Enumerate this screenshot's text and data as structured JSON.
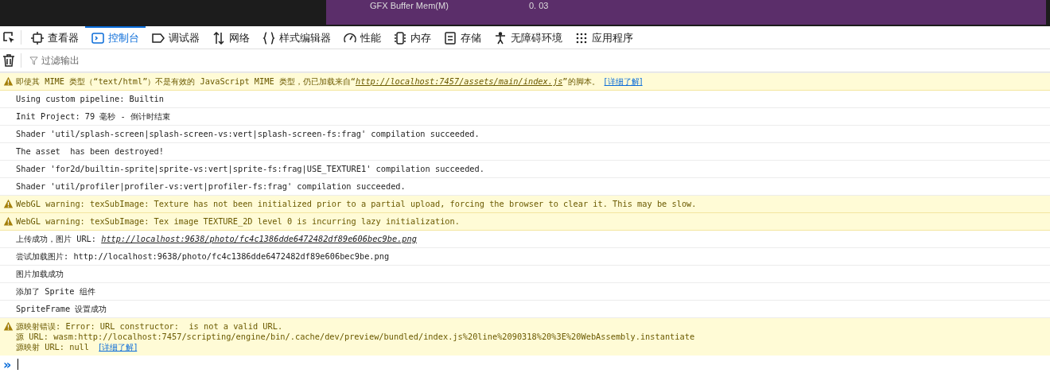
{
  "game_overlay": {
    "stats": [
      {
        "label": "GFX Buffer Mem(M)",
        "value": "0. 03"
      }
    ]
  },
  "tabs": [
    {
      "label": "查看器",
      "kind": "inspector",
      "selected": false
    },
    {
      "label": "控制台",
      "kind": "console",
      "selected": true
    },
    {
      "label": "调试器",
      "kind": "debugger",
      "selected": false
    },
    {
      "label": "网络",
      "kind": "network",
      "selected": false
    },
    {
      "label": "样式编辑器",
      "kind": "style",
      "selected": false
    },
    {
      "label": "性能",
      "kind": "performance",
      "selected": false
    },
    {
      "label": "内存",
      "kind": "memory",
      "selected": false
    },
    {
      "label": "存储",
      "kind": "storage",
      "selected": false
    },
    {
      "label": "无障碍环境",
      "kind": "accessibility",
      "selected": false
    },
    {
      "label": "应用程序",
      "kind": "application",
      "selected": false
    }
  ],
  "filter": {
    "placeholder": "过滤输出"
  },
  "messages": [
    {
      "kind": "warning",
      "lines": [
        [
          {
            "kind": "text",
            "t": "即使其 MIME 类型（“text/html”）不是有效的 JavaScript MIME 类型，仍已加载来自“"
          },
          {
            "kind": "url",
            "t": "http://localhost:7457/assets/main/index.js"
          },
          {
            "kind": "text",
            "t": "”的脚本。"
          },
          {
            "kind": "learn",
            "t": "[详细了解]"
          }
        ]
      ]
    },
    {
      "kind": "log",
      "lines": [
        [
          {
            "kind": "text",
            "t": "Using custom pipeline: Builtin"
          }
        ]
      ]
    },
    {
      "kind": "log",
      "lines": [
        [
          {
            "kind": "text",
            "t": "Init Project: 79 毫秒 - 倒计时结束"
          }
        ]
      ]
    },
    {
      "kind": "log",
      "lines": [
        [
          {
            "kind": "text",
            "t": "Shader 'util/splash-screen|splash-screen-vs:vert|splash-screen-fs:frag' compilation succeeded."
          }
        ]
      ]
    },
    {
      "kind": "log",
      "lines": [
        [
          {
            "kind": "text",
            "t": "The asset  has been destroyed!"
          }
        ]
      ]
    },
    {
      "kind": "log",
      "lines": [
        [
          {
            "kind": "text",
            "t": "Shader 'for2d/builtin-sprite|sprite-vs:vert|sprite-fs:frag|USE_TEXTURE1' compilation succeeded."
          }
        ]
      ]
    },
    {
      "kind": "log",
      "lines": [
        [
          {
            "kind": "text",
            "t": "Shader 'util/profiler|profiler-vs:vert|profiler-fs:frag' compilation succeeded."
          }
        ]
      ]
    },
    {
      "kind": "warning",
      "lines": [
        [
          {
            "kind": "text",
            "t": "WebGL warning: texSubImage: Texture has not been initialized prior to a partial upload, forcing the browser to clear it. This may be slow."
          }
        ]
      ]
    },
    {
      "kind": "warning",
      "lines": [
        [
          {
            "kind": "text",
            "t": "WebGL warning: texSubImage: Tex image TEXTURE_2D level 0 is incurring lazy initialization."
          }
        ]
      ]
    },
    {
      "kind": "log",
      "lines": [
        [
          {
            "kind": "text",
            "t": "上传成功，图片 URL: "
          },
          {
            "kind": "url",
            "t": "http://localhost:9638/photo/fc4c1386dde6472482df89e606bec9be.png"
          }
        ]
      ]
    },
    {
      "kind": "log",
      "lines": [
        [
          {
            "kind": "text",
            "t": "尝试加载图片: http://localhost:9638/photo/fc4c1386dde6472482df89e606bec9be.png"
          }
        ]
      ]
    },
    {
      "kind": "log",
      "lines": [
        [
          {
            "kind": "text",
            "t": "图片加载成功"
          }
        ]
      ]
    },
    {
      "kind": "log",
      "lines": [
        [
          {
            "kind": "text",
            "t": "添加了 Sprite 组件"
          }
        ]
      ]
    },
    {
      "kind": "log",
      "lines": [
        [
          {
            "kind": "text",
            "t": "SpriteFrame 设置成功"
          }
        ]
      ]
    },
    {
      "kind": "warning",
      "lines": [
        [
          {
            "kind": "text",
            "t": "源映射错误: Error: URL constructor:  is not a valid URL."
          }
        ],
        [
          {
            "kind": "text",
            "t": "源 URL: wasm:http://localhost:7457/scripting/engine/bin/.cache/dev/preview/bundled/index.js%20line%2090318%20%3E%20WebAssembly.instantiate"
          }
        ],
        [
          {
            "kind": "text",
            "t": "源映射 URL: null "
          },
          {
            "kind": "learn",
            "t": "[详细了解]"
          }
        ]
      ]
    }
  ],
  "prompt": {
    "symbol": "»"
  }
}
